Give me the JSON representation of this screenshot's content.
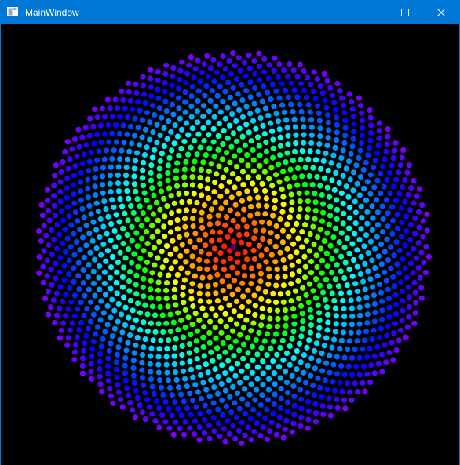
{
  "window": {
    "title": "MainWindow",
    "title_bar_color": "#0078d7",
    "background_color": "#000000"
  },
  "icons": {
    "app": "window-app-icon",
    "minimize": "minimize-icon",
    "maximize": "maximize-icon",
    "close": "close-icon"
  },
  "visualization": {
    "type": "phyllotaxis-spiral",
    "color_gradient": [
      "#ff0000",
      "#ff8000",
      "#ffff00",
      "#00ff00",
      "#00ffff",
      "#0080ff",
      "#0000ff",
      "#8000ff"
    ],
    "center_color": "#4b0082"
  }
}
